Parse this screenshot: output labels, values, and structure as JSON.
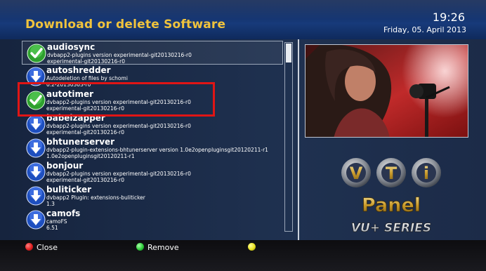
{
  "header": {
    "title": "Download or delete Software",
    "time": "19:26",
    "date": "Friday, 05. April 2013"
  },
  "list": {
    "items": [
      {
        "name": "audiosync",
        "line1": "dvbapp2-plugins version experimental-git20130216-r0",
        "line2": "experimental-git20130216-r0",
        "icon": "check-installed-icon"
      },
      {
        "name": "autoshredder",
        "line1": "Autodeletion of files by schomi",
        "line2": "0.2-20130303-r0",
        "icon": "download-arrow-icon"
      },
      {
        "name": "autotimer",
        "line1": "dvbapp2-plugins version experimental-git20130216-r0",
        "line2": "experimental-git20130216-r0",
        "icon": "check-installed-icon"
      },
      {
        "name": "babelzapper",
        "line1": "dvbapp2-plugins version experimental-git20130216-r0",
        "line2": "experimental-git20130216-r0",
        "icon": "download-arrow-icon"
      },
      {
        "name": "bhtunerserver",
        "line1": "dvbapp2-plugin-extensions-bhtunerserver version 1.0e2openpluginsgit20120211-r1",
        "line2": "1.0e2openpluginsgit20120211-r1",
        "icon": "download-arrow-icon"
      },
      {
        "name": "bonjour",
        "line1": "dvbapp2-plugins version experimental-git20130216-r0",
        "line2": "experimental-git20130216-r0",
        "icon": "download-arrow-icon"
      },
      {
        "name": "buliticker",
        "line1": "dvbapp2 Plugin: extensions-buliticker",
        "line2": "1.3",
        "icon": "download-arrow-icon"
      },
      {
        "name": "camofs",
        "line1": "camoFS",
        "line2": "6.51",
        "icon": "download-arrow-icon"
      }
    ]
  },
  "logo": {
    "letters": [
      "V",
      "T",
      "i"
    ],
    "panel": "Panel",
    "series": "VU+ SERIES"
  },
  "footer": {
    "close": "Close",
    "remove": "Remove",
    "colors": {
      "red": "#e02020",
      "green": "#2ecc3a",
      "yellow": "#e8e020"
    }
  },
  "colors": {
    "title": "#f0c33c",
    "selection_border": "#e01515"
  }
}
